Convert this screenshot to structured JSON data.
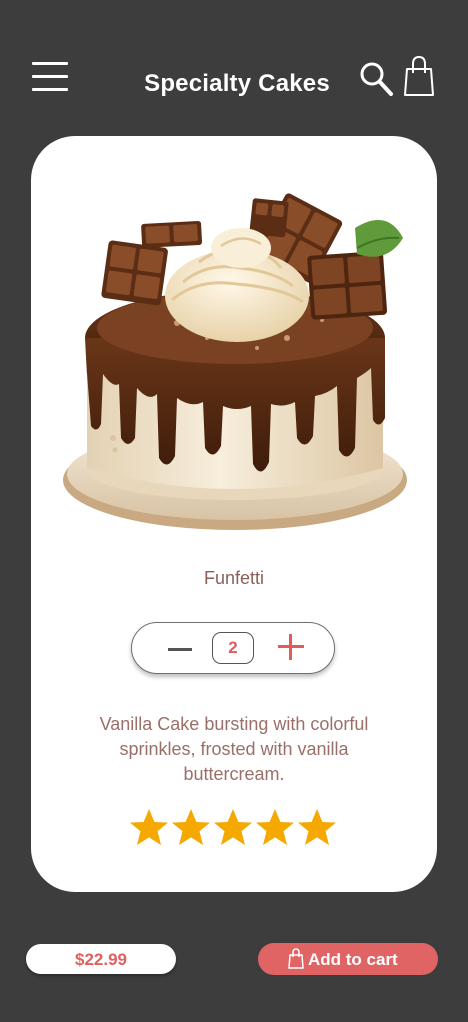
{
  "header": {
    "title": "Specialty Cakes",
    "menu_icon": "hamburger-menu-icon",
    "search_icon": "search-icon",
    "bag_icon": "shopping-bag-icon"
  },
  "product": {
    "name": "Funfetti",
    "quantity": "2",
    "description": "Vanilla Cake bursting with colorful sprinkles, frosted with vanilla buttercream.",
    "rating": 5,
    "rating_max": 5,
    "image": "chocolate-drip-cake-image"
  },
  "footer": {
    "price": "$22.99",
    "add_to_cart_label": "Add to cart"
  },
  "colors": {
    "background": "#3d3d3d",
    "card": "#ffffff",
    "accent": "#e06464",
    "star": "#f5a800",
    "text_muted": "#8a5f5a"
  }
}
